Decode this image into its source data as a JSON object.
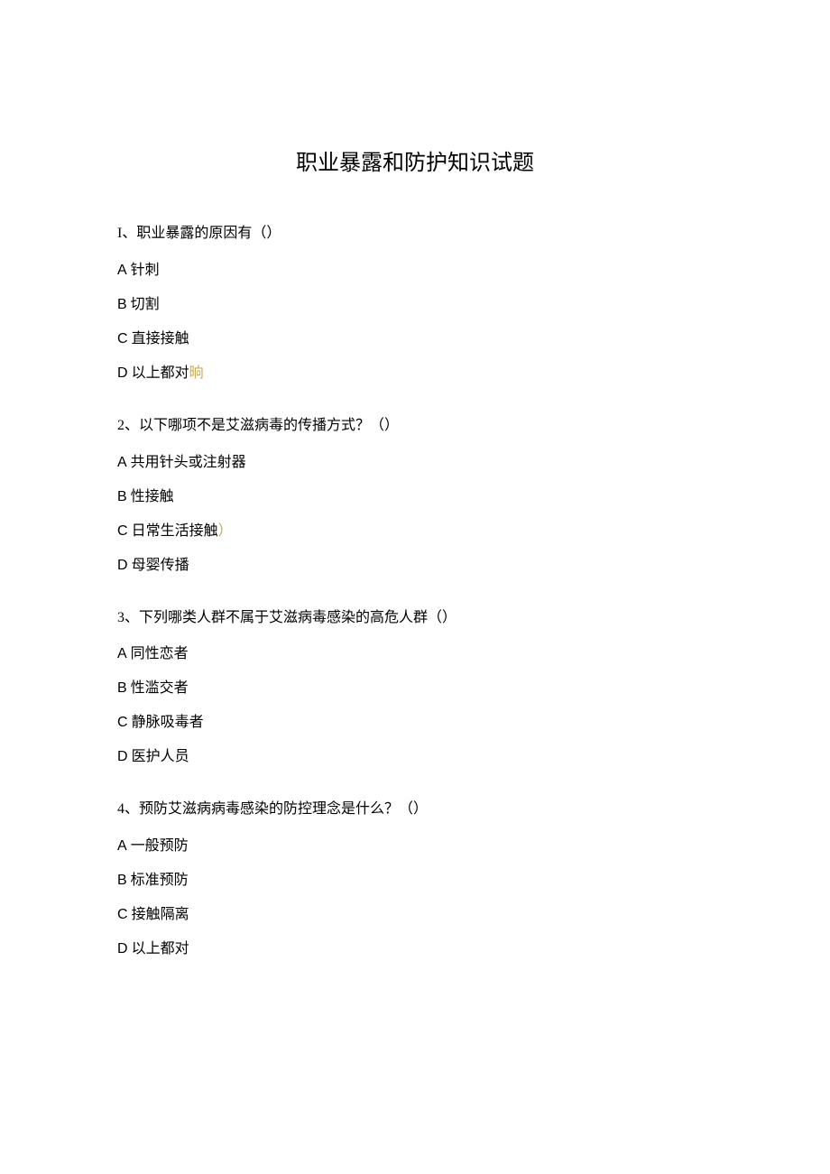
{
  "title": "职业暴露和防护知识试题",
  "questions": [
    {
      "number": "I",
      "text": "职业暴露的原因有（）",
      "options": [
        {
          "prefix": "A",
          "text": "针刺",
          "highlight": ""
        },
        {
          "prefix": "B",
          "text": "切割",
          "highlight": ""
        },
        {
          "prefix": "C",
          "text": "直接接触",
          "highlight": ""
        },
        {
          "prefix": "D",
          "text": "以上都对",
          "highlight": "晌"
        }
      ]
    },
    {
      "number": "2",
      "text": "以下哪项不是艾滋病毒的传播方式？（）",
      "options": [
        {
          "prefix": "A",
          "text": "共用针头或注射器",
          "highlight": ""
        },
        {
          "prefix": "B",
          "text": "性接触",
          "highlight": ""
        },
        {
          "prefix": "C",
          "text": "日常生活接触",
          "highlight": "）"
        },
        {
          "prefix": "D",
          "text": "母婴传播",
          "highlight": ""
        }
      ]
    },
    {
      "number": "3",
      "text": "下列哪类人群不属于艾滋病毒感染的高危人群（）",
      "options": [
        {
          "prefix": "A",
          "text": "同性恋者",
          "highlight": ""
        },
        {
          "prefix": "B",
          "text": "性滥交者",
          "highlight": ""
        },
        {
          "prefix": "C",
          "text": "静脉吸毒者",
          "highlight": ""
        },
        {
          "prefix": "D",
          "text": "医护人员",
          "highlight": ""
        }
      ]
    },
    {
      "number": "4",
      "text": "预防艾滋病病毒感染的防控理念是什么？（）",
      "options": [
        {
          "prefix": "A",
          "text": "一般预防",
          "highlight": ""
        },
        {
          "prefix": "B",
          "text": "标准预防",
          "highlight": ""
        },
        {
          "prefix": "C",
          "text": "接触隔离",
          "highlight": ""
        },
        {
          "prefix": "D",
          "text": "以上都对",
          "highlight": ""
        }
      ]
    }
  ]
}
